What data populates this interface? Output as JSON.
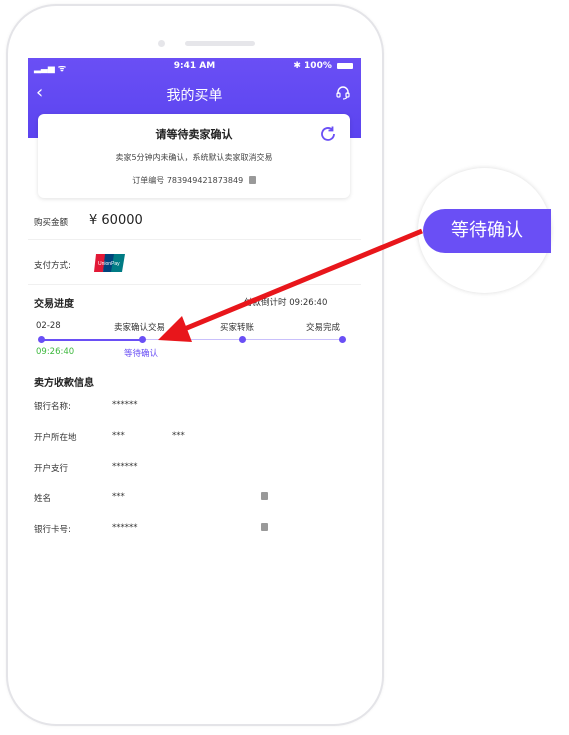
{
  "status": {
    "signal": "📶",
    "time": "9:41 AM",
    "battery": "100%"
  },
  "nav": {
    "back": "‹",
    "title": "我的买单"
  },
  "card": {
    "title": "请等待卖家确认",
    "desc": "卖家5分钟内未确认，系统默认卖家取消交易",
    "order_label": "订单编号 783949421873849"
  },
  "amount": {
    "label": "购买金额",
    "value": "¥ 60000"
  },
  "payment": {
    "label": "支付方式:",
    "logo": "UnionPay"
  },
  "progress": {
    "title": "交易进度",
    "countdown": "付款倒计时 09:26:40",
    "date": "02-28",
    "time": "09:26:40",
    "steps": [
      "卖家确认交易",
      "买家转账",
      "交易完成"
    ],
    "current": "等待确认"
  },
  "seller": {
    "title": "卖方收款信息",
    "rows": [
      {
        "label": "银行名称:",
        "value": "******"
      },
      {
        "label": "开户所在地",
        "value": "***",
        "value2": "***"
      },
      {
        "label": "开户支行",
        "value": "******"
      },
      {
        "label": "姓名",
        "value": "***"
      },
      {
        "label": "银行卡号:",
        "value": "******"
      }
    ]
  },
  "callout": {
    "text": "等待确认"
  },
  "colors": {
    "primary": "#6a4ff5",
    "arrow": "#e8161b",
    "green": "#3db83d"
  }
}
